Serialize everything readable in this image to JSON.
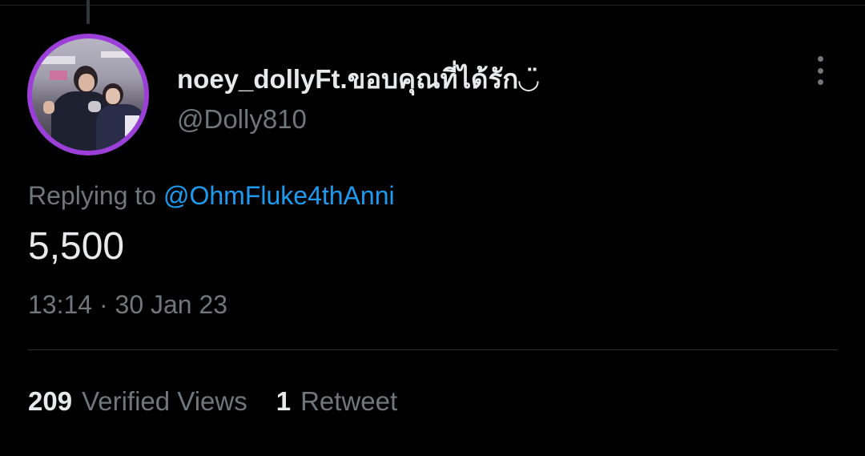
{
  "tweet": {
    "display_name": "noey_dollyFt.ขอบคุณที่ได้รัก◡̈",
    "handle": "@Dolly810",
    "replying_prefix": "Replying to",
    "replying_to": "@OhmFluke4thAnni",
    "text": "5,500",
    "time": "13:14",
    "separator": "·",
    "date": "30 Jan 23"
  },
  "stats": {
    "views_count": "209",
    "views_label": "Verified Views",
    "retweet_count": "1",
    "retweet_label": "Retweet"
  },
  "icons": {
    "more": "more-vertical-icon"
  },
  "colors": {
    "background": "#000000",
    "text_primary": "#e7e9ea",
    "text_secondary": "#71767b",
    "link": "#1d9bf0",
    "avatar_ring": "#9b3fd8"
  }
}
